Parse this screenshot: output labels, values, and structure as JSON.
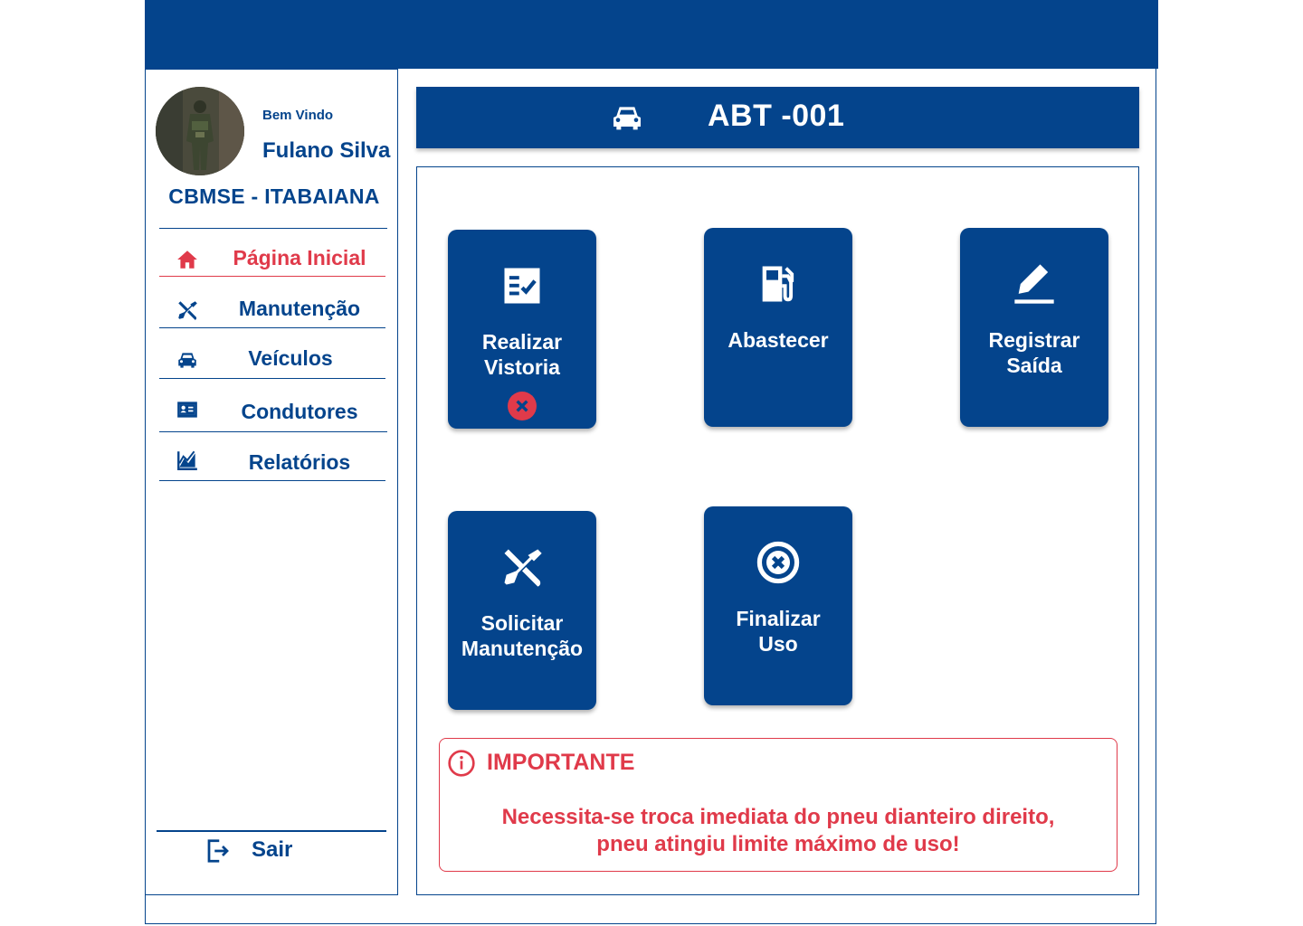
{
  "colors": {
    "primary": "#04448c",
    "danger": "#e03a4a",
    "background": "#ffffff"
  },
  "user": {
    "welcome": "Bem Vindo",
    "name": "Fulano Silva",
    "unit": "CBMSE - ITABAIANA",
    "avatar_icon": "user-avatar-photo"
  },
  "sidebar": {
    "items": [
      {
        "label": "Página Inicial",
        "icon": "home-icon",
        "active": true
      },
      {
        "label": "Manutenção",
        "icon": "tools-icon",
        "active": false
      },
      {
        "label": "Veículos",
        "icon": "car-icon",
        "active": false
      },
      {
        "label": "Condutores",
        "icon": "id-card-icon",
        "active": false
      },
      {
        "label": "Relatórios",
        "icon": "chart-icon",
        "active": false
      }
    ],
    "logout": {
      "label": "Sair",
      "icon": "logout-icon"
    }
  },
  "vehicle": {
    "plate": "ABT -001",
    "icon": "car-icon"
  },
  "actions": [
    {
      "label": "Realizar\nVistoria",
      "icon": "checklist-icon",
      "status": "pending",
      "status_icon": "close-icon"
    },
    {
      "label": "Abastecer",
      "icon": "fuel-pump-icon"
    },
    {
      "label": "Registrar\nSaída",
      "icon": "pencil-icon"
    },
    {
      "label": "Solicitar\nManutenção",
      "icon": "tools-icon"
    },
    {
      "label": "Finalizar\nUso",
      "icon": "close-circle-icon"
    }
  ],
  "alert": {
    "title": "IMPORTANTE",
    "icon": "info-icon",
    "message": "Necessita-se troca imediata do pneu dianteiro direito,\npneu atingiu limite máximo de uso!"
  }
}
